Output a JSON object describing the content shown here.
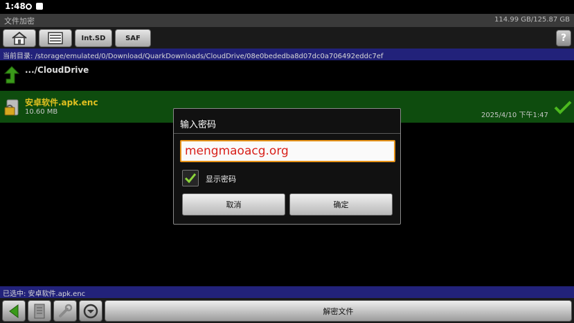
{
  "status_bar": {
    "time": "1:48"
  },
  "title_bar": {
    "app_title": "文件加密",
    "storage": "114.99 GB/125.87 GB"
  },
  "toolbar": {
    "int_sd_label": "Int.SD",
    "saf_label": "SAF",
    "help_label": "?"
  },
  "path_bar": {
    "text": "当前目录: /storage/emulated/0/Download/QuarkDownloads/CloudDrive/08e0bededba8d07dc0a706492eddc7ef"
  },
  "file_list": {
    "up_label": ".../CloudDrive",
    "items": [
      {
        "name": "安卓软件.apk.enc",
        "size": "10.60 MB",
        "date": "2025/4/10 下午1:47"
      }
    ]
  },
  "dialog": {
    "title": "输入密码",
    "password_value": "mengmaoacg.org",
    "show_password_label": "显示密码",
    "cancel_label": "取消",
    "ok_label": "确定"
  },
  "selection_bar": {
    "text": "已选中: 安卓软件.apk.enc"
  },
  "bottom_bar": {
    "decrypt_label": "解密文件"
  },
  "colors": {
    "accent_green": "#4cb81e",
    "selection_bg": "#0e4c0e",
    "path_bg": "#22227a",
    "input_border": "#e8941a",
    "input_text": "#d8201a"
  }
}
